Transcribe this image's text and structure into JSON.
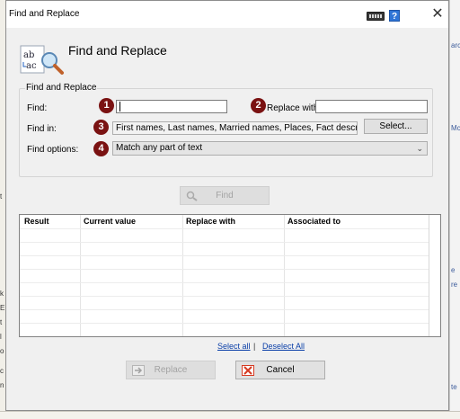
{
  "background": {
    "right_texts": [
      "arc",
      "Mc",
      "e",
      "re",
      "te"
    ],
    "left_texts": [
      "t",
      "k",
      "E",
      "t",
      "l",
      "o",
      "c",
      "n"
    ]
  },
  "dialog": {
    "title": "Find and Replace",
    "header_title": "Find and Replace",
    "help_label": "?",
    "close_label": "✕"
  },
  "group": {
    "label": "Find and Replace",
    "find_label": "Find:",
    "find_value": "",
    "replace_label": "Replace with:",
    "replace_value": "",
    "find_in_label": "Find in:",
    "find_in_value": "First names, Last names, Married names, Places, Fact descriptions, Notes",
    "select_button": "Select...",
    "options_label": "Find options:",
    "options_value": "Match any part of text",
    "badges": [
      "1",
      "2",
      "3",
      "4"
    ]
  },
  "find_button": "Find",
  "results": {
    "columns": [
      "Result",
      "Current value",
      "Replace with",
      "Associated to"
    ],
    "rows": []
  },
  "links": {
    "select_all": "Select all",
    "separator": "|",
    "deselect_all": "Deselect All"
  },
  "replace_button": "Replace",
  "cancel_button": "Cancel",
  "colors": {
    "badge": "#7a1212",
    "link": "#0b3fa8",
    "help": "#2f75d6",
    "cancel_icon": "#d63a22"
  }
}
